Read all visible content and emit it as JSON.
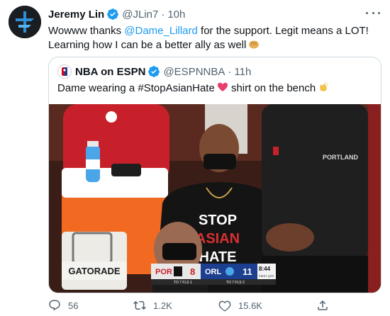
{
  "tweet": {
    "author_name": "Jeremy Lin",
    "author_handle": "@JLin7",
    "separator": "·",
    "time": "10h",
    "text_line1_pre": "Wowww thanks ",
    "mention": "@Dame_Lillard",
    "text_line1_post": " for the support. Legit means a LOT!",
    "text_line2": "Learning how I can be a better ally as well"
  },
  "quote": {
    "author_name": "NBA on ESPN",
    "author_handle": "@ESPNNBA",
    "separator": "·",
    "time": "11h",
    "text_pre": "Dame wearing a #StopAsianHate",
    "text_post": " shirt on the bench"
  },
  "media": {
    "cooler_brand": "GATORADE",
    "shirt_line1": "STOP",
    "shirt_line2": "ASIAN",
    "shirt_line3": "HATE",
    "jersey_text": "PORTLAND",
    "scorebug": {
      "home_team": "POR",
      "home_score": "8",
      "away_team": "ORL",
      "away_score": "11",
      "clock": "8:44",
      "period": "FIRST QTR",
      "home_sub": "TO 7   FLS 1",
      "away_sub": "TO 7   FLS 2"
    }
  },
  "actions": {
    "replies": "56",
    "retweets": "1.2K",
    "likes": "15.6K"
  },
  "colors": {
    "accent": "#1d9bf0",
    "muted": "#536471",
    "border": "#cfd9de"
  }
}
